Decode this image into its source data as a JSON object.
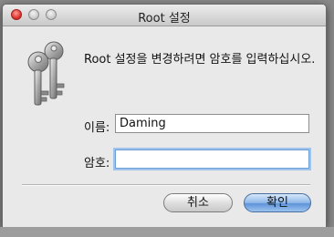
{
  "window": {
    "title": "Root 설정"
  },
  "dialog": {
    "message": "Root 설정을 변경하려면 암호를 입력하십시오.",
    "name_label": "이름:",
    "name_value": "Daming",
    "password_label": "암호:",
    "password_value": ""
  },
  "buttons": {
    "cancel_label": "취소",
    "ok_label": "확인"
  },
  "icons": {
    "window_controls": [
      "close-icon",
      "minimize-icon",
      "zoom-icon"
    ],
    "dialog_icon": "keys-icon"
  },
  "colors": {
    "close": "#d8271f",
    "default_button": "#5f93d9",
    "focus_ring": "#9fc3ea"
  }
}
